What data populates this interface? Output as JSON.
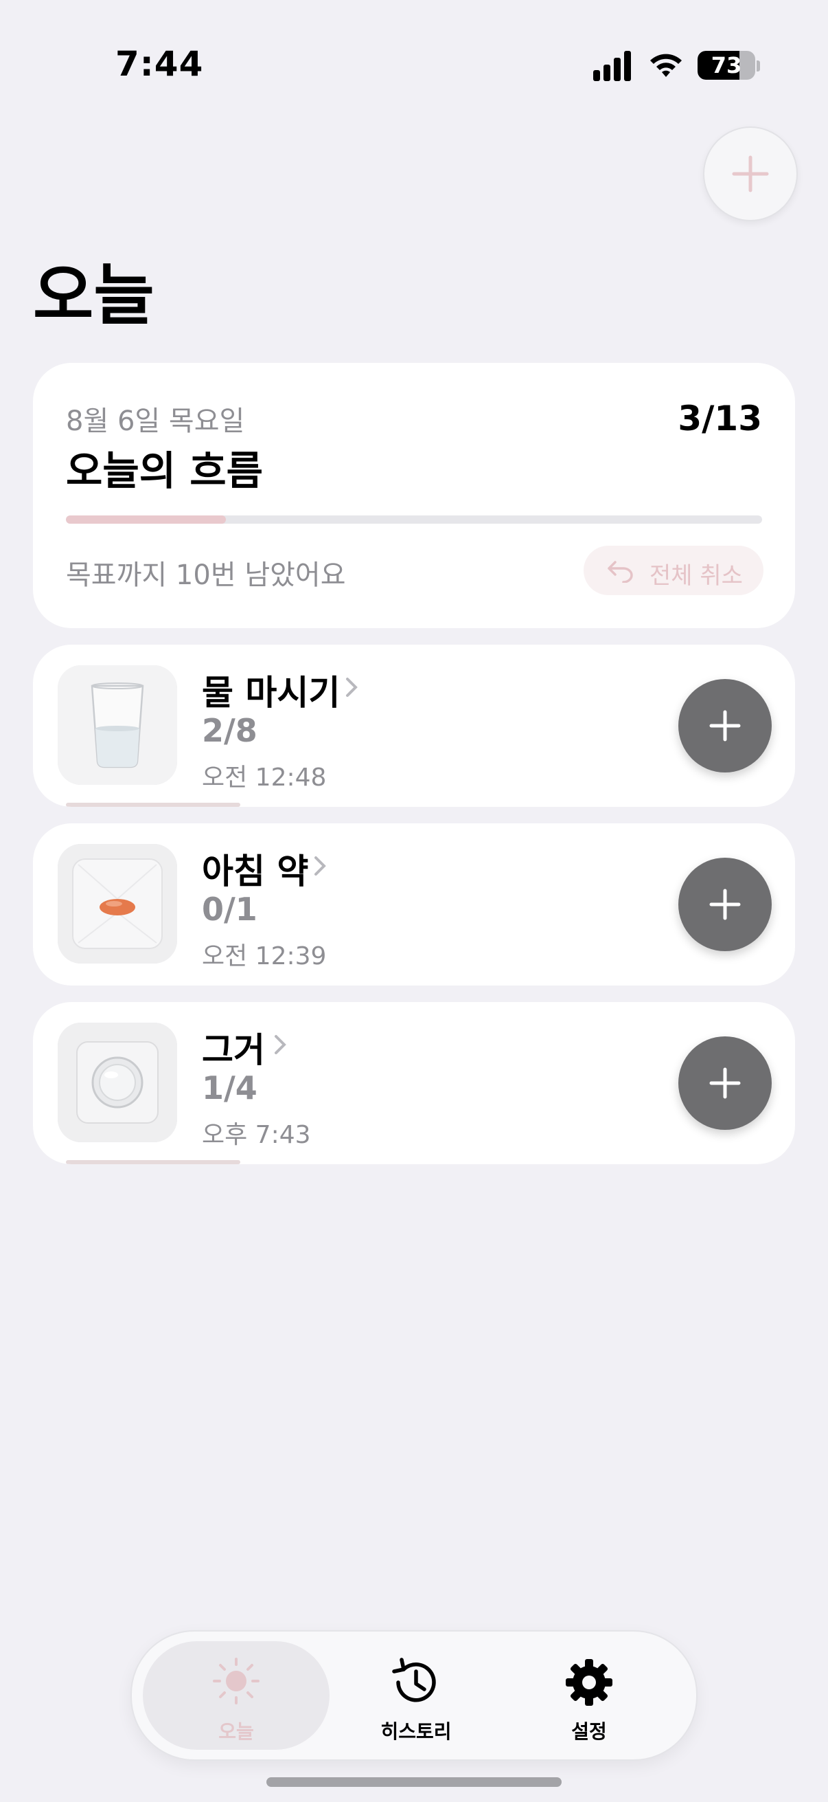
{
  "status_bar": {
    "time": "7:44",
    "battery": "73"
  },
  "header": {
    "title": "오늘",
    "add_icon": "plus-icon"
  },
  "summary": {
    "date": "8월 6일 목요일",
    "title": "오늘의 흐름",
    "count": "3/13",
    "progress": 0.23,
    "remaining": "목표까지 10번 남았어요",
    "undo_label": "전체 취소",
    "accent": "#e9c9cd"
  },
  "items": [
    {
      "name": "물 마시기",
      "count": "2/8",
      "time": "오전 12:48",
      "image": "water-glass",
      "progress": 0.25
    },
    {
      "name": "아침 약",
      "count": "0/1",
      "time": "오전 12:39",
      "image": "orange-pill",
      "progress": 0
    },
    {
      "name": "그거",
      "count": "1/4",
      "time": "오후 7:43",
      "image": "blister-pill",
      "progress": 0.25
    }
  ],
  "tabbar": {
    "tabs": [
      {
        "label": "오늘",
        "icon": "sun-icon",
        "active": true
      },
      {
        "label": "히스토리",
        "icon": "history-icon",
        "active": false
      },
      {
        "label": "설정",
        "icon": "gear-icon",
        "active": false
      }
    ]
  }
}
